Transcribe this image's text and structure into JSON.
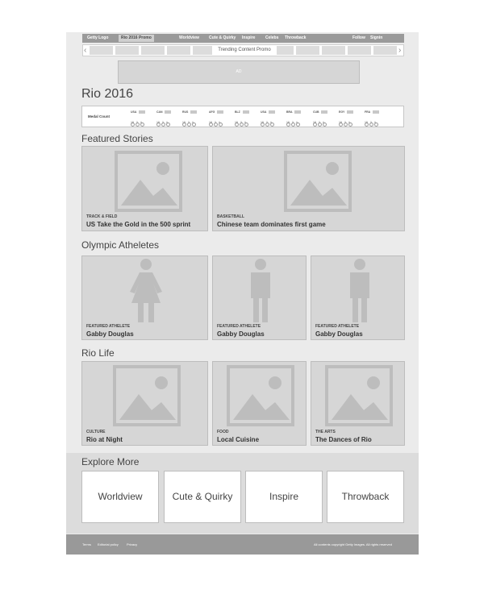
{
  "nav": {
    "logo": "Getty Logo",
    "promo": "Rio 2016 Promo",
    "links": [
      "Worldview",
      "Cute & Quirky",
      "Inspire",
      "Celebs",
      "Throwback"
    ],
    "follow": "Follow",
    "signin": "Signin"
  },
  "trending": {
    "label": "Trending Content Promo"
  },
  "ad": {
    "label": "AD"
  },
  "rio": {
    "title": "Rio 2016"
  },
  "medals": {
    "label": "Medal Count",
    "countries": [
      {
        "code": "USA",
        "nums": "15 2 4"
      },
      {
        "code": "CAN",
        "nums": "15 2 4"
      },
      {
        "code": "RUS",
        "nums": "15 2 4"
      },
      {
        "code": "AFG",
        "nums": "15 2 4"
      },
      {
        "code": "BLZ",
        "nums": "15 2 4"
      },
      {
        "code": "USA",
        "nums": "15 2 4"
      },
      {
        "code": "BRA",
        "nums": "15 2 4"
      },
      {
        "code": "CUB",
        "nums": "15 2 4"
      },
      {
        "code": "EGY",
        "nums": "15 2 4"
      },
      {
        "code": "FRA",
        "nums": "15 2 4"
      }
    ]
  },
  "featured": {
    "title": "Featured Stories",
    "cards": [
      {
        "category": "TRACK & FIELD",
        "title": "US Take the Gold in the 500 sprint"
      },
      {
        "category": "BASKETBALL",
        "title": "Chinese team dominates first game"
      }
    ]
  },
  "athletes": {
    "title": "Olympic Atheletes",
    "cards": [
      {
        "category": "FEATURED ATHELETE",
        "name": "Gabby Douglas",
        "icon": "female-figure-icon"
      },
      {
        "category": "FEATURED ATHELETE",
        "name": "Gabby Douglas",
        "icon": "male-figure-icon"
      },
      {
        "category": "FEATURED ATHELETE",
        "name": "Gabby Douglas",
        "icon": "male-figure-icon"
      }
    ]
  },
  "rio_life": {
    "title": "Rio Life",
    "cards": [
      {
        "category": "CULTURE",
        "title": "Rio at Night"
      },
      {
        "category": "FOOD",
        "title": "Local Cuisine"
      },
      {
        "category": "THE ARTS",
        "title": "The Dances of Rio"
      }
    ]
  },
  "explore": {
    "title": "Explore More",
    "items": [
      "Worldview",
      "Cute & Quirky",
      "Inspire",
      "Throwback"
    ]
  },
  "footer": {
    "links": [
      "Terms",
      "Editorial policy",
      "Privacy"
    ],
    "copyright": "All contents copyright Getty Images. All rights reserved"
  },
  "colors": {
    "placeholder": "#d6d6d6",
    "nav": "#9a9a9a",
    "footer": "#999999",
    "background": "#ebebeb"
  }
}
